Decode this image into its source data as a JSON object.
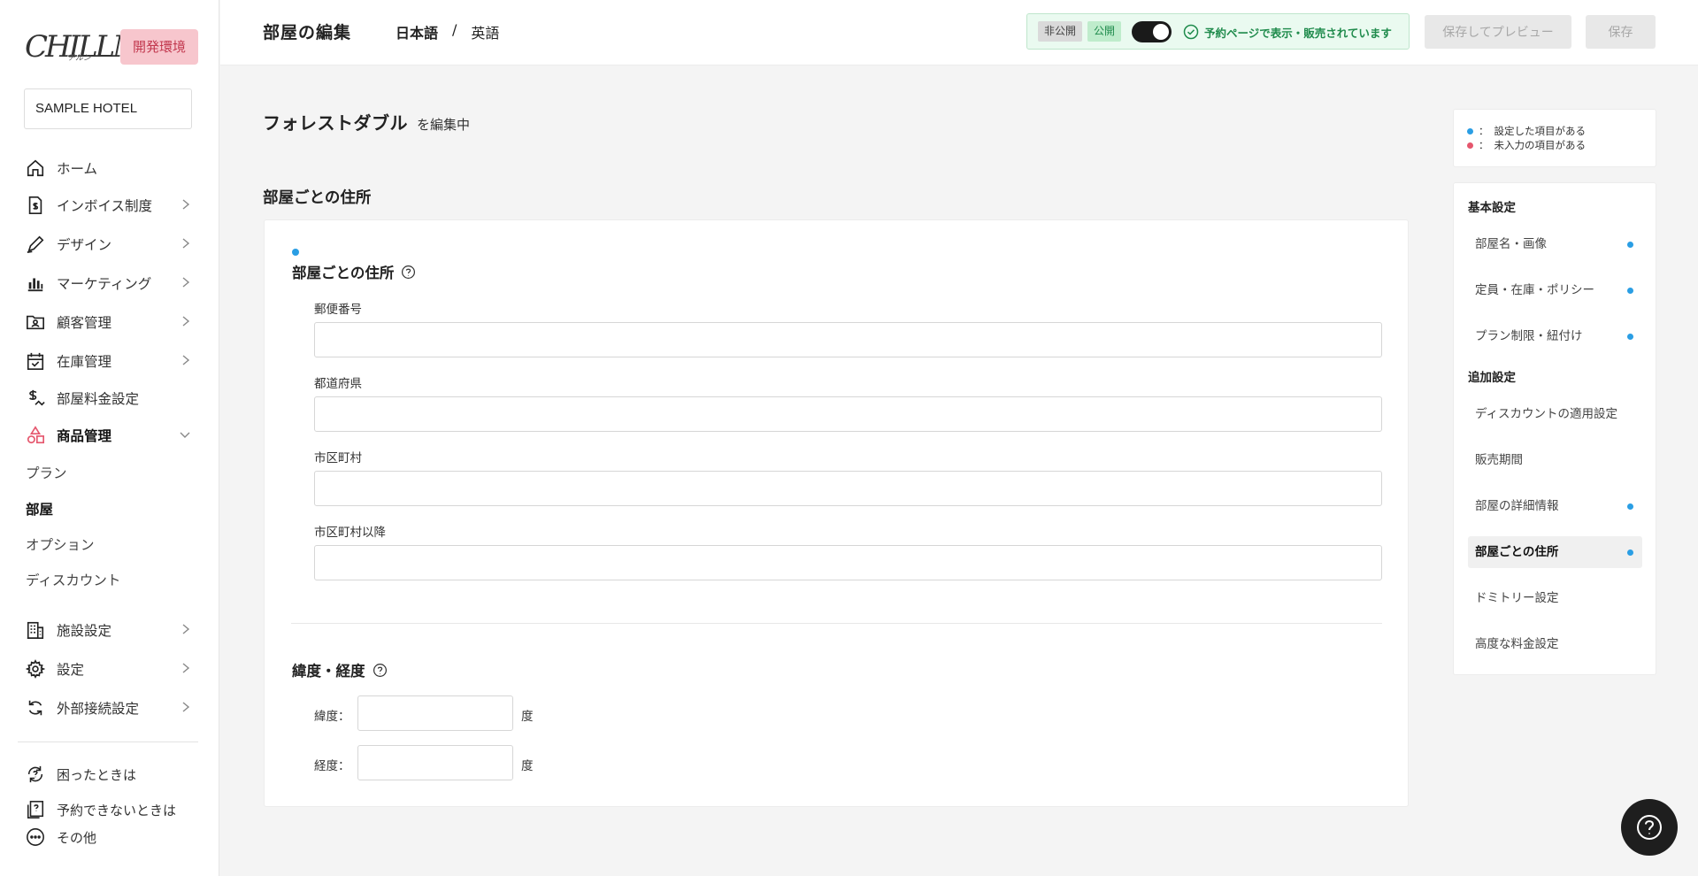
{
  "sidebar": {
    "logo_text": "CHILLNN",
    "logo_sub": "チルン",
    "env_badge": "開発環境",
    "hotel": "SAMPLE HOTEL",
    "items": [
      {
        "label": "ホーム",
        "icon": "home-icon"
      },
      {
        "label": "インボイス制度",
        "icon": "invoice-icon"
      },
      {
        "label": "デザイン",
        "icon": "pen-icon"
      },
      {
        "label": "マーケティング",
        "icon": "bar-chart-icon"
      },
      {
        "label": "顧客管理",
        "icon": "customer-folder-icon"
      },
      {
        "label": "在庫管理",
        "icon": "calendar-check-icon"
      },
      {
        "label": "部屋料金設定",
        "icon": "price-icon"
      },
      {
        "label": "商品管理",
        "icon": "shapes-icon"
      },
      {
        "label": "施設設定",
        "icon": "building-icon"
      },
      {
        "label": "設定",
        "icon": "gear-icon"
      },
      {
        "label": "外部接続設定",
        "icon": "sync-icon"
      }
    ],
    "sub_items": [
      "プラン",
      "部屋",
      "オプション",
      "ディスカウント"
    ],
    "footer": [
      {
        "label": "困ったときは",
        "icon": "help-cycle-icon"
      },
      {
        "label": "予約できないときは",
        "icon": "book-icon"
      },
      {
        "label": "その他",
        "icon": "more-icon"
      }
    ]
  },
  "header": {
    "title": "部屋の編集",
    "lang_current": "日本語",
    "lang_sep": "/",
    "lang_other": "英語",
    "badge_private": "非公開",
    "badge_public": "公開",
    "status_text": "予約ページで表示・販売されています",
    "preview_button": "保存してプレビュー",
    "save_button": "保存",
    "status_color": "#1f8b4c"
  },
  "main": {
    "room_name": "フォレストダブル",
    "editing_suffix": "を編集中",
    "section_title": "部屋ごとの住所",
    "address_heading": "部屋ごとの住所",
    "fields": [
      {
        "label": "郵便番号",
        "value": ""
      },
      {
        "label": "都道府県",
        "value": ""
      },
      {
        "label": "市区町村",
        "value": ""
      },
      {
        "label": "市区町村以降",
        "value": ""
      }
    ],
    "coords_heading": "緯度・経度",
    "latitude_label": "緯度：",
    "longitude_label": "経度：",
    "unit": "度"
  },
  "legend": {
    "set_label": "設定した項目がある",
    "empty_label": "未入力の項目がある",
    "prefix": "：",
    "set_color": "#2a9ee4",
    "empty_color": "#e5566d"
  },
  "nav_panel": {
    "group_basic": "基本設定",
    "basic": [
      {
        "label": "部屋名・画像",
        "dot": true
      },
      {
        "label": "定員・在庫・ポリシー",
        "dot": true
      },
      {
        "label": "プラン制限・紐付け",
        "dot": true
      }
    ],
    "group_extra": "追加設定",
    "extra": [
      {
        "label": "ディスカウントの適用設定",
        "dot": false
      },
      {
        "label": "販売期間",
        "dot": false
      },
      {
        "label": "部屋の詳細情報",
        "dot": true
      },
      {
        "label": "部屋ごとの住所",
        "dot": true,
        "current": true
      },
      {
        "label": "ドミトリー設定",
        "dot": false
      },
      {
        "label": "高度な料金設定",
        "dot": false
      }
    ]
  }
}
